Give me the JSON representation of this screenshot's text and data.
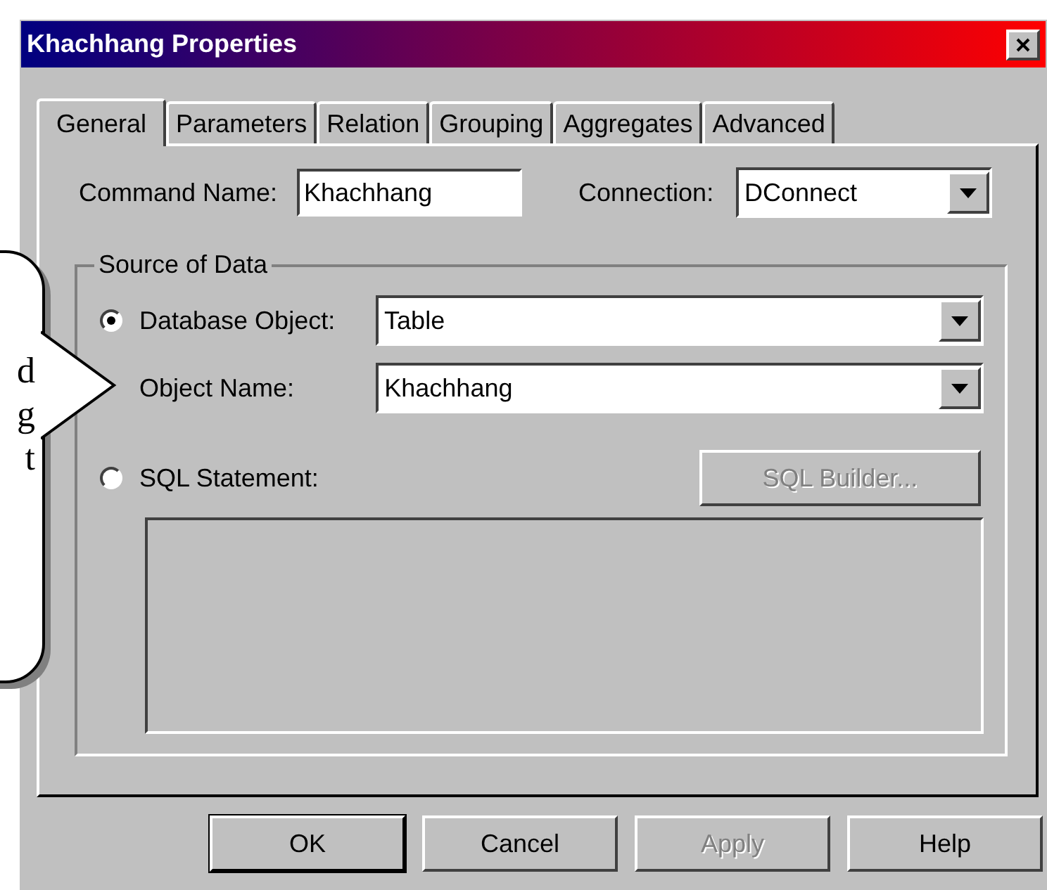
{
  "window": {
    "title": "Khachhang Properties"
  },
  "tabs": [
    {
      "label": "General",
      "selected": true
    },
    {
      "label": "Parameters",
      "selected": false
    },
    {
      "label": "Relation",
      "selected": false
    },
    {
      "label": "Grouping",
      "selected": false
    },
    {
      "label": "Aggregates",
      "selected": false
    },
    {
      "label": "Advanced",
      "selected": false
    }
  ],
  "command_name": {
    "label": "Command Name:",
    "value": "Khachhang"
  },
  "connection": {
    "label": "Connection:",
    "value": "DConnect"
  },
  "source_of_data": {
    "title": "Source of Data",
    "database_object": {
      "label": "Database Object:",
      "selected": true,
      "value": "Table"
    },
    "object_name": {
      "label": "Object Name:",
      "value": "Khachhang"
    },
    "sql_statement": {
      "label": "SQL Statement:",
      "selected": false
    },
    "sql_builder": {
      "label": "SQL Builder...",
      "disabled": true
    },
    "sql_text": {
      "disabled": true
    }
  },
  "buttons": [
    {
      "label": "OK",
      "default": true,
      "disabled": false
    },
    {
      "label": "Cancel",
      "default": false,
      "disabled": false
    },
    {
      "label": "Apply",
      "default": false,
      "disabled": true
    },
    {
      "label": "Help",
      "default": false,
      "disabled": false
    }
  ],
  "callout": {
    "lines": [
      "d",
      "g",
      "t"
    ]
  }
}
